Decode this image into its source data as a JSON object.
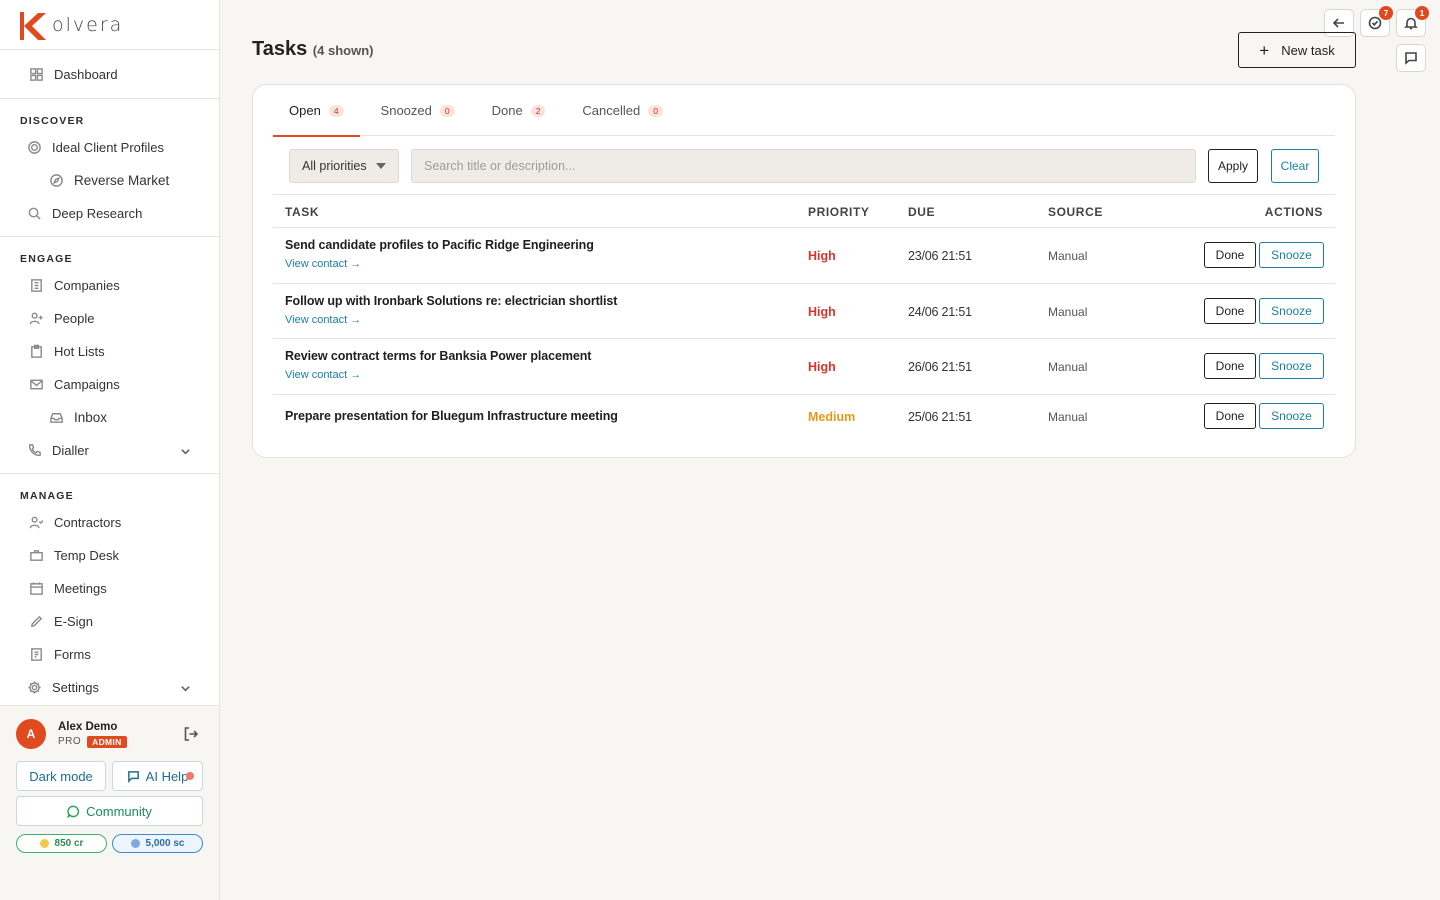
{
  "brand": {
    "name": "olvera",
    "mark": "K"
  },
  "sidebar": {
    "dashboard": "Dashboard",
    "discover": {
      "title": "DISCOVER",
      "items": [
        "Ideal Client Profiles",
        "Reverse Market",
        "Deep Research"
      ]
    },
    "engage": {
      "title": "ENGAGE",
      "items": [
        "Companies",
        "People",
        "Hot Lists",
        "Campaigns",
        "Inbox",
        "Dialler"
      ]
    },
    "manage": {
      "title": "MANAGE",
      "items": [
        "Contractors",
        "Temp Desk",
        "Meetings",
        "E-Sign",
        "Forms",
        "Settings"
      ]
    }
  },
  "user": {
    "initial": "A",
    "name": "Alex Demo",
    "plan": "PRO",
    "role": "ADMIN",
    "dark_mode": "Dark mode",
    "ai_help": "AI Help",
    "community": "Community",
    "credits": "850 cr",
    "sc": "5,000 sc"
  },
  "top": {
    "tasks_badge": "7",
    "notif_badge": "1"
  },
  "page": {
    "title": "Tasks",
    "subtitle": "(4 shown)",
    "new_task": "New task"
  },
  "tabs": [
    {
      "label": "Open",
      "count": "4"
    },
    {
      "label": "Snoozed",
      "count": "0"
    },
    {
      "label": "Done",
      "count": "2"
    },
    {
      "label": "Cancelled",
      "count": "0"
    }
  ],
  "filters": {
    "priority": "All priorities",
    "search_placeholder": "Search title or description...",
    "apply": "Apply",
    "clear": "Clear"
  },
  "table": {
    "headers": {
      "task": "TASK",
      "priority": "PRIORITY",
      "due": "DUE",
      "source": "SOURCE",
      "actions": "ACTIONS"
    },
    "view_contact": "View contact →",
    "done": "Done",
    "snooze": "Snooze",
    "rows": [
      {
        "title": "Send candidate profiles to Pacific Ridge Engineering",
        "priority": "High",
        "due": "23/06 21:51",
        "source": "Manual"
      },
      {
        "title": "Follow up with Ironbark Solutions re: electrician shortlist",
        "priority": "High",
        "due": "24/06 21:51",
        "source": "Manual"
      },
      {
        "title": "Review contract terms for Banksia Power placement",
        "priority": "High",
        "due": "26/06 21:51",
        "source": "Manual"
      },
      {
        "title": "Prepare presentation for Bluegum Infrastructure meeting",
        "priority": "Medium",
        "due": "25/06 21:51",
        "source": "Manual"
      }
    ]
  },
  "colors": {
    "accent": "#e04a1f",
    "link": "#1c7fa5",
    "high": "#d8352b",
    "medium": "#e39a1b"
  }
}
